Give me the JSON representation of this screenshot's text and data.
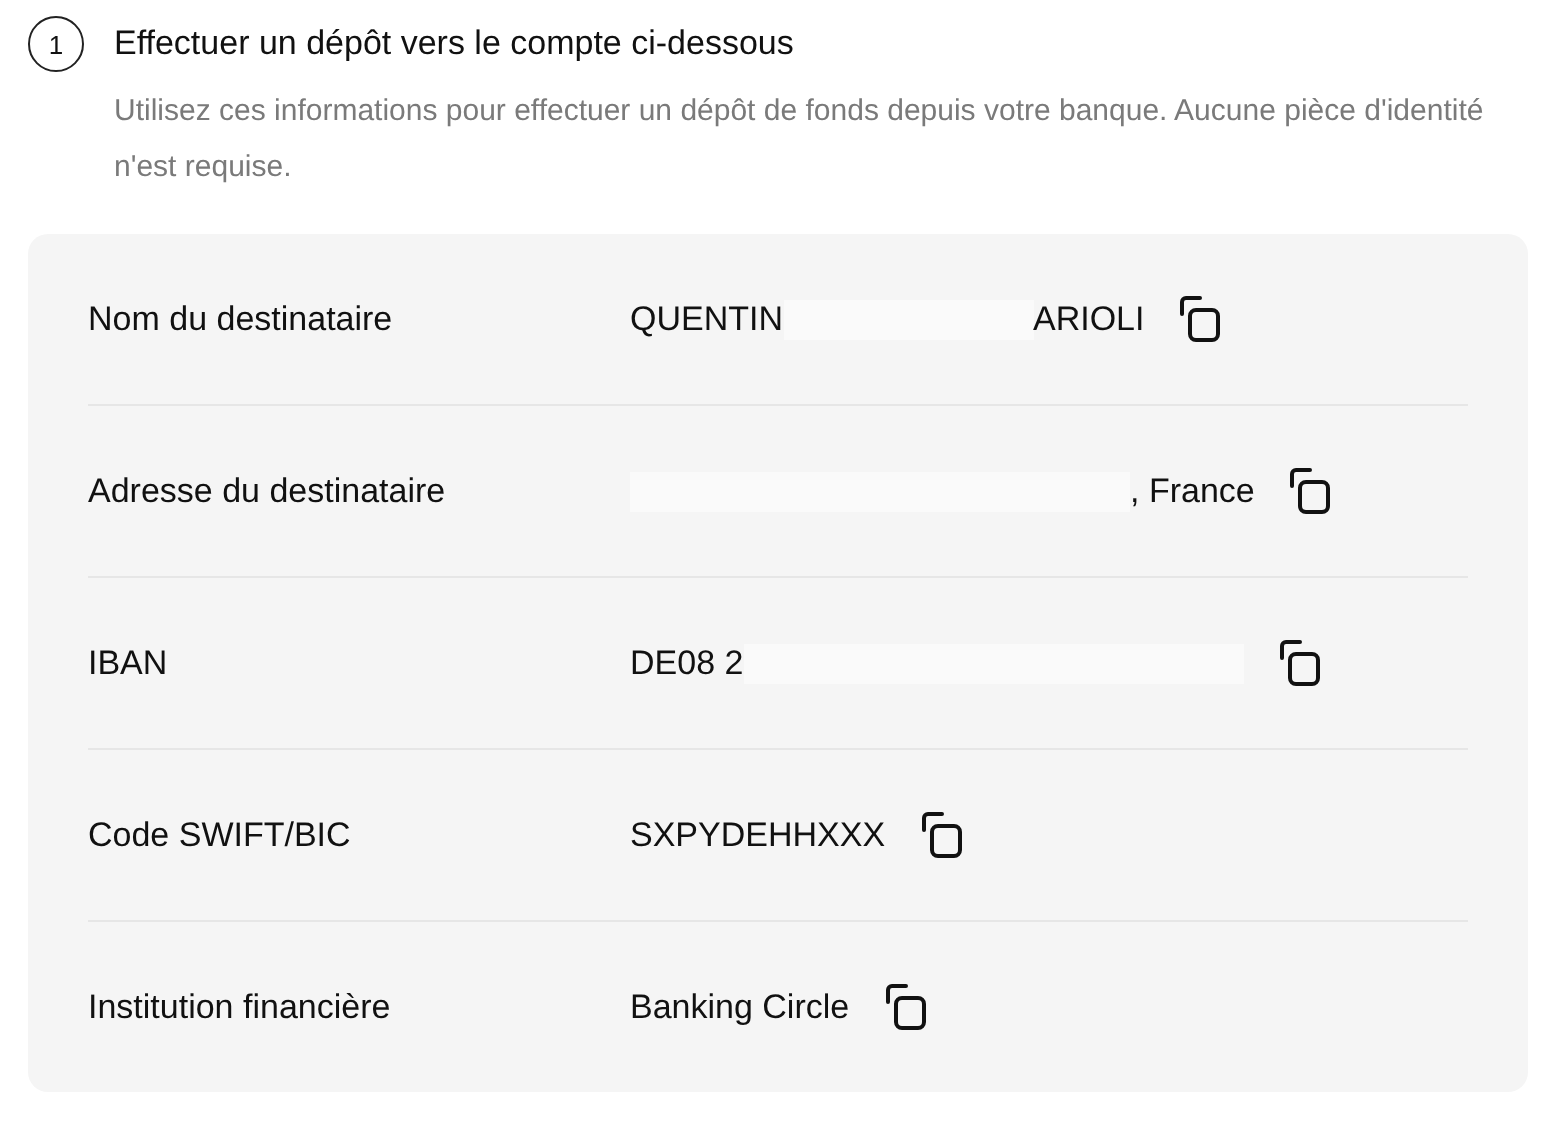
{
  "step": {
    "number": "1",
    "title": "Effectuer un dépôt vers le compte ci-dessous",
    "description": "Utilisez ces informations pour effectuer un dépôt de fonds depuis votre banque. Aucune pièce d'identité n'est requise."
  },
  "details": [
    {
      "label": "Nom du destinataire",
      "value": [
        {
          "kind": "text",
          "text": "QUENTIN"
        },
        {
          "kind": "redacted"
        },
        {
          "kind": "text",
          "text": "ARIOLI"
        }
      ]
    },
    {
      "label": "Adresse du destinataire",
      "value": [
        {
          "kind": "redacted"
        },
        {
          "kind": "redacted"
        },
        {
          "kind": "text",
          "text": ", France"
        }
      ]
    },
    {
      "label": "IBAN",
      "value": [
        {
          "kind": "text",
          "text": "DE08 2"
        },
        {
          "kind": "redacted"
        },
        {
          "kind": "redacted"
        }
      ]
    },
    {
      "label": "Code SWIFT/BIC",
      "value": [
        {
          "kind": "text",
          "text": "SXPYDEHHXXX"
        }
      ]
    },
    {
      "label": "Institution financière",
      "value": [
        {
          "kind": "text",
          "text": "Banking Circle"
        }
      ]
    }
  ]
}
